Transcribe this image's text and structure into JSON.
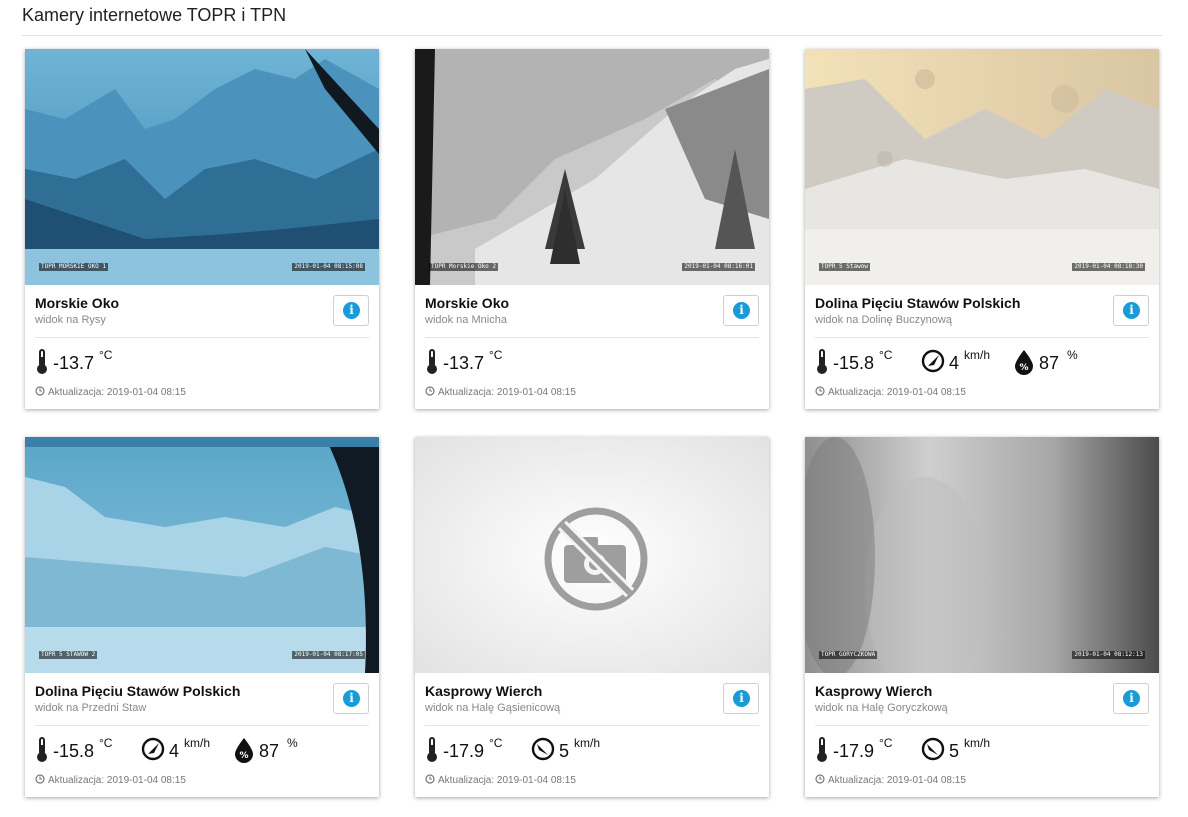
{
  "page": {
    "title": "Kamery internetowe TOPR i TPN"
  },
  "update_label": "Aktualizacja:",
  "cards": [
    {
      "name": "Morskie Oko",
      "subtitle": "widok na Rysy",
      "camera": {
        "overlay_label": "TOPR MORSKIE OKO 1",
        "overlay_time": "2019-01-04 08:15:08"
      },
      "temperature": "-13.7",
      "temperature_unit": "°C",
      "updated": "2019-01-04 08:15"
    },
    {
      "name": "Morskie Oko",
      "subtitle": "widok na Mnicha",
      "camera": {
        "overlay_label": "TOPR Morskie Oko 2",
        "overlay_time": "2019-01-04 08:16:01"
      },
      "temperature": "-13.7",
      "temperature_unit": "°C",
      "updated": "2019-01-04 08:15"
    },
    {
      "name": "Dolina Pięciu Stawów Polskich",
      "subtitle": "widok na Dolinę Buczynową",
      "camera": {
        "overlay_label": "TOPR 5 Stawow",
        "overlay_time": "2019-01-04 08:18:30"
      },
      "temperature": "-15.8",
      "temperature_unit": "°C",
      "wind": "4",
      "wind_unit": "km/h",
      "humidity": "87",
      "humidity_unit": "%",
      "updated": "2019-01-04 08:15"
    },
    {
      "name": "Dolina Pięciu Stawów Polskich",
      "subtitle": "widok na Przedni Staw",
      "camera": {
        "overlay_label": "TOPR 5 STAWOW 2",
        "overlay_time": "2019-01-04 08:17:05"
      },
      "temperature": "-15.8",
      "temperature_unit": "°C",
      "wind": "4",
      "wind_unit": "km/h",
      "humidity": "87",
      "humidity_unit": "%",
      "updated": "2019-01-04 08:15"
    },
    {
      "name": "Kasprowy Wierch",
      "subtitle": "widok na Halę Gąsienicową",
      "camera": {
        "unavailable": true,
        "icon": "no-camera-icon"
      },
      "temperature": "-17.9",
      "temperature_unit": "°C",
      "wind": "5",
      "wind_unit": "km/h",
      "updated": "2019-01-04 08:15"
    },
    {
      "name": "Kasprowy Wierch",
      "subtitle": "widok na Halę Goryczkową",
      "camera": {
        "overlay_label": "TOPR GORYCZKOWA",
        "overlay_time": "2019-01-04 08:12:13"
      },
      "temperature": "-17.9",
      "temperature_unit": "°C",
      "wind": "5",
      "wind_unit": "km/h",
      "updated": "2019-01-04 08:15"
    }
  ]
}
